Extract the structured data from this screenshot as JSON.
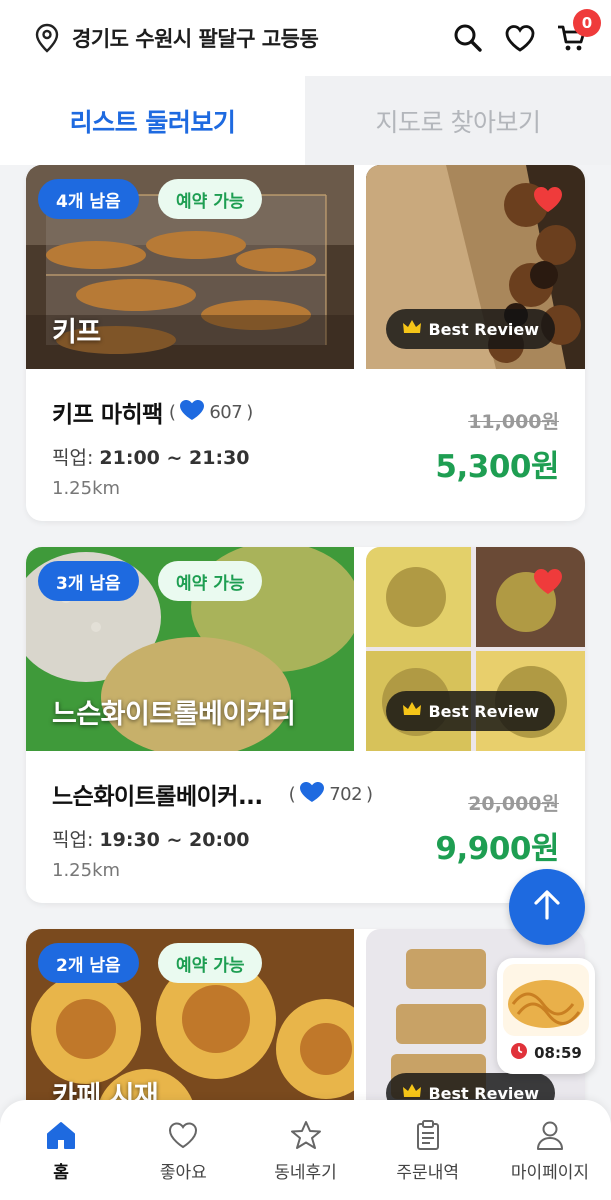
{
  "header": {
    "location": "경기도 수원시 팔달구 고등동",
    "cart_count": "0"
  },
  "tabs": [
    {
      "label": "리스트 둘러보기",
      "active": true
    },
    {
      "label": "지도로 찾아보기",
      "active": false
    }
  ],
  "cards": [
    {
      "remaining": "4개 남음",
      "reservation": "예약 가능",
      "store_overlay": "키프",
      "best_review": "Best Review",
      "title": "키프 마히팩",
      "likes_open": "(",
      "likes": "607",
      "likes_close": ")",
      "pickup_label": "픽업:",
      "pickup_time": "21:00 ~ 21:30",
      "distance": "1.25km",
      "original_price": "11,000원",
      "sale_price": "5,300원"
    },
    {
      "remaining": "3개 남음",
      "reservation": "예약 가능",
      "store_overlay": "느슨화이트롤베이커리",
      "best_review": "Best Review",
      "title": "느슨화이트롤베이커...",
      "likes_open": "(",
      "likes": "702",
      "likes_close": ")",
      "pickup_label": "픽업:",
      "pickup_time": "19:30 ~ 20:00",
      "distance": "1.25km",
      "original_price": "20,000원",
      "sale_price": "9,900원"
    },
    {
      "remaining": "2개 남음",
      "reservation": "예약 가능",
      "store_overlay": "카페 시재",
      "best_review": "Best Review"
    }
  ],
  "mini_player": {
    "timer": "08:59"
  },
  "bottom_nav": [
    {
      "label": "홈",
      "icon": "home-icon",
      "active": true
    },
    {
      "label": "좋아요",
      "icon": "heart-outline-icon",
      "active": false
    },
    {
      "label": "동네후기",
      "icon": "star-icon",
      "active": false
    },
    {
      "label": "주문내역",
      "icon": "clipboard-icon",
      "active": false
    },
    {
      "label": "마이페이지",
      "icon": "person-icon",
      "active": false
    }
  ],
  "colors": {
    "primary": "#1e6ae0",
    "sale": "#1e9e52",
    "badge_red": "#ef3b3b",
    "heart_red": "#ef3b3b"
  }
}
